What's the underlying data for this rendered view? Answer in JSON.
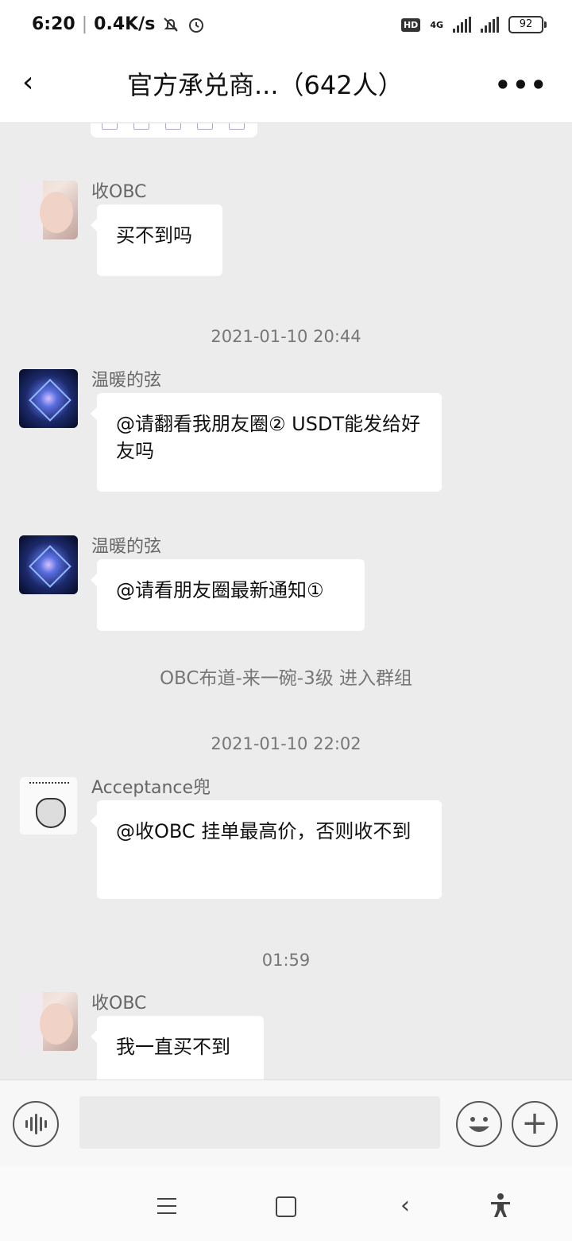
{
  "status_bar": {
    "time": "6:20",
    "speed": "0.4K/s",
    "network": "4G",
    "hd": "HD",
    "battery": "92"
  },
  "header": {
    "back_icon": "‹",
    "title": "官方承兑商...（642人）",
    "more_icon": "•••"
  },
  "messages": [
    {
      "type": "msg",
      "sender": "收OBC",
      "text": "买不到吗",
      "avatar": "girl-avatar"
    },
    {
      "type": "time",
      "text": "2021-01-10 20:44"
    },
    {
      "type": "msg",
      "sender": "温暖的弦",
      "text": "@请翻看我朋友圈② USDT能发给好友吗",
      "avatar": "orb-avatar"
    },
    {
      "type": "msg",
      "sender": "温暖的弦",
      "text": "@请看朋友圈最新通知①",
      "avatar": "orb-avatar"
    },
    {
      "type": "system",
      "text": "OBC布道-来一碗-3级 进入群组"
    },
    {
      "type": "time",
      "text": "2021-01-10 22:02"
    },
    {
      "type": "msg",
      "sender": "Acceptance兜",
      "text": "@收OBC 挂单最高价，否则收不到",
      "avatar": "sketch-avatar"
    },
    {
      "type": "time",
      "text": "01:59"
    },
    {
      "type": "msg",
      "sender": "收OBC",
      "text": "我一直买不到",
      "avatar": "girl-avatar"
    }
  ],
  "input_bar": {
    "voice_icon": "voice-icon",
    "emoji_icon": "emoji-icon",
    "plus_icon": "+",
    "input_value": ""
  },
  "nav_bar": {
    "menu_icon": "menu-icon",
    "home_icon": "home-icon",
    "back_icon": "‹",
    "accessibility_icon": "accessibility-icon"
  }
}
